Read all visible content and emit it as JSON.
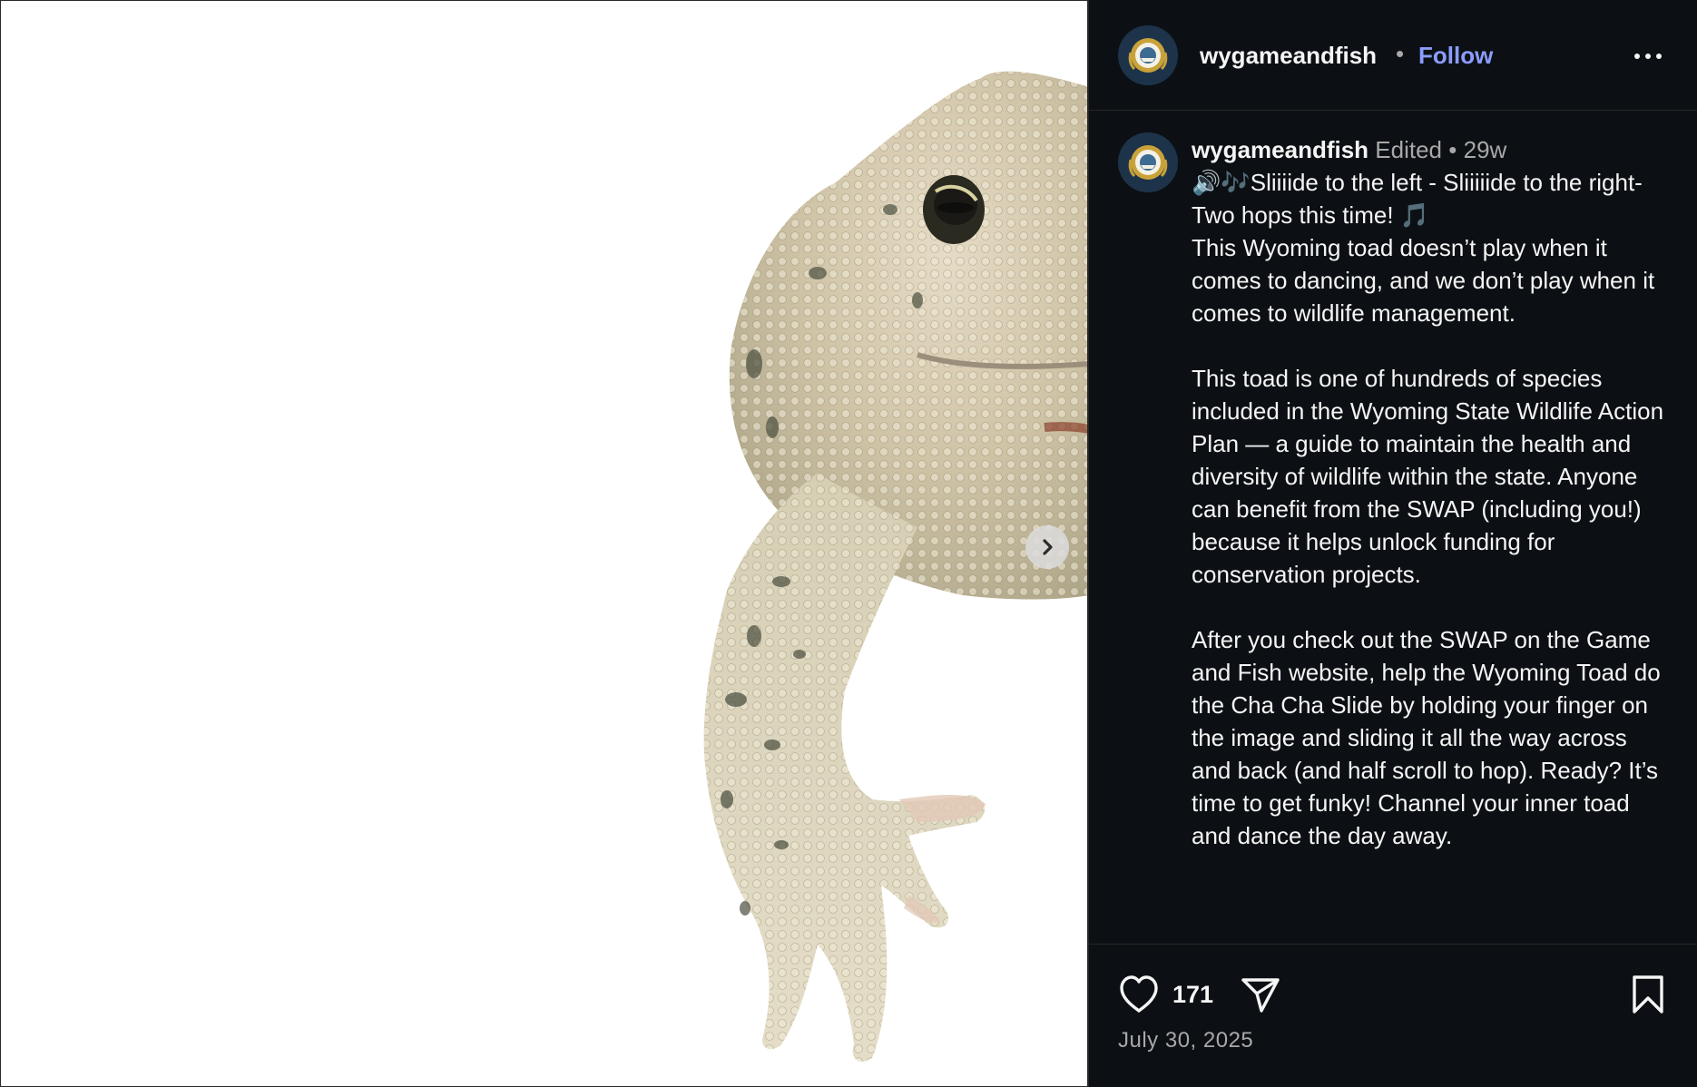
{
  "header": {
    "username": "wygameandfish",
    "separator": "•",
    "follow_label": "Follow"
  },
  "caption": {
    "username": "wygameandfish",
    "edited": "Edited",
    "separator": "•",
    "time_ago": "29w",
    "paragraphs": [
      "🔊🎶Sliiiide to the left - Sliiiiide to the right- Two hops this time! 🎵\nThis Wyoming toad doesn’t play when it comes to dancing, and we don’t play when it comes to wildlife management.",
      "This toad is one of hundreds of species included in the Wyoming State Wildlife Action Plan — a guide to maintain the health and diversity of wildlife within the state. Anyone can benefit from the SWAP (including you!) because it helps unlock funding for conservation projects.",
      "After you check out the SWAP on the Game and Fish website, help the Wyoming Toad do the Cha Cha Slide by holding your finger on the image and sliding it all the way across and back (and half scroll to hop). Ready? It’s time to get funky! Channel your inner toad and dance the day away."
    ]
  },
  "footer": {
    "likes": "171",
    "date": "July 30, 2025"
  },
  "icons": {
    "like": "heart-icon",
    "share": "paper-plane-icon",
    "save": "bookmark-icon",
    "more": "ellipsis-icon",
    "next": "chevron-right-icon"
  },
  "colors": {
    "panel_bg": "#0c1014",
    "follow": "#8c9cff",
    "muted": "#a8a8a8",
    "media_bg": "#ffffff"
  }
}
